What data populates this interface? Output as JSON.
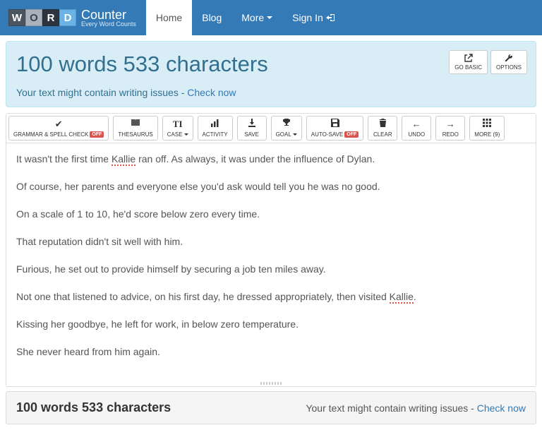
{
  "brand": {
    "tiles": [
      "W",
      "O",
      "R",
      "D"
    ],
    "title": "Counter",
    "tagline": "Every Word Counts"
  },
  "nav": {
    "items": [
      "Home",
      "Blog",
      "More",
      "Sign In"
    ],
    "active": 0
  },
  "panel": {
    "heading_prefix": "100 words 533 characters",
    "issues_text": "Your text might contain writing issues - ",
    "check_link": "Check now",
    "go_basic": "GO BASIC",
    "options": "OPTIONS"
  },
  "toolbar": {
    "grammar": "GRAMMAR & SPELL CHECK",
    "off": "OFF",
    "thesaurus": "THESAURUS",
    "case": "CASE",
    "activity": "ACTIVITY",
    "save": "SAVE",
    "goal": "GOAL",
    "autosave": "AUTO-SAVE",
    "clear": "CLEAR",
    "undo": "UNDO",
    "redo": "REDO",
    "more": "MORE (9)"
  },
  "text_paragraphs": [
    "It wasn't the first time Kallie ran off. As always, it was under the influence of Dylan.",
    "Of course, her parents and everyone else you'd ask would tell you he was no good.",
    "On a scale of 1 to 10, he'd score below zero every time.",
    "That reputation didn't sit well with him.",
    "Furious, he set out to provide himself by securing a job ten miles away.",
    "Not one that listened to advice, on his first day,  he dressed appropriately, then visited Kallie.",
    "Kissing her goodbye, he left for work, in below zero temperature.",
    "She never heard from him again."
  ],
  "footer": {
    "count": "100 words 533 characters",
    "issues": "Your text might contain writing issues - ",
    "check": "Check now"
  }
}
